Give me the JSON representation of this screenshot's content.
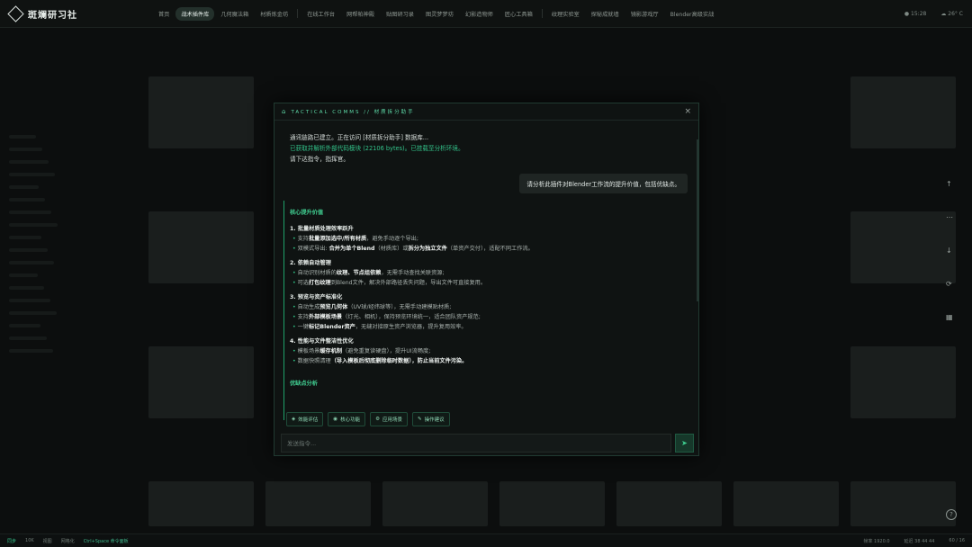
{
  "header": {
    "brand": "斑斓研习社",
    "nav": [
      "首页",
      "战术插件库",
      "几何魔法箱",
      "材质炼金坊",
      "在线工作台",
      "网帮帕神殿",
      "贴图研习录",
      "图灵梦梦坊",
      "幻影造物师",
      "匠心工具箱",
      "纹理实验室",
      "探秘成就墙",
      "镜影游戏厅",
      "Blender高级实战"
    ],
    "active_index": 1,
    "time": "15:28",
    "weather": "26° C"
  },
  "modal": {
    "title": "TACTICAL COMMS // 材质拆分助手",
    "close": "×",
    "system_lines": [
      "通讯链路已建立。正在访问 [材质拆分助手] 数据库...",
      "已获取并解析外部代码模块 (22106 bytes)。已挂载至分析环境。",
      "请下达指令，指挥官。"
    ],
    "user_message": "请分析此插件对Blender工作流的提升价值，包括优缺点。",
    "response": {
      "heading": "核心提升价值",
      "sections": [
        {
          "title": "1. 批量材质处理效率跃升",
          "items": [
            [
              "支持",
              "批量添加选中/所有材质",
              "，避免手动逐个导出;"
            ],
            [
              "双模式导出: ",
              "合并为单个Blend",
              "（材质库）或",
              "拆分为独立文件",
              "（单资产交付），适配不同工作流。"
            ]
          ]
        },
        {
          "title": "2. 依赖自动管理",
          "items": [
            [
              "自动识别材质的",
              "纹理、节点组依赖",
              "，无需手动查找关联资源;"
            ],
            [
              "可选",
              "打包纹理",
              "到Blend文件，解决外部路径丢失问题，导出文件可直接复用。"
            ]
          ]
        },
        {
          "title": "3. 预览与资产标准化",
          "items": [
            [
              "自动生成",
              "预览几何体",
              "（UV球/经纬球等），无需手动建模贴材质;"
            ],
            [
              "支持",
              "外部模板场景",
              "（灯光、相机），保持预览环境统一，适合团队资产规范;"
            ],
            [
              "一键",
              "标记Blender资产",
              "，无缝对接原生资产浏览器，提升复用效率。"
            ]
          ]
        },
        {
          "title": "4. 性能与文件整洁性优化",
          "items": [
            [
              "模板场景",
              "缓存机制",
              "（避免重复读硬盘），提升UI流畅度;"
            ],
            [
              "数据快照清理",
              "（导入模板后彻底删除临时数据），防止当前文件污染。"
            ]
          ]
        }
      ],
      "next_heading": "优缺点分析"
    },
    "chips": [
      "效能评估",
      "核心功能",
      "应用场景",
      "操作建议"
    ],
    "input_placeholder": "发送指令..."
  },
  "status": {
    "left": [
      "同步",
      "10K",
      "视图",
      "网格化",
      "Ctrl+Space 命令面板"
    ],
    "right": [
      "帧率  1920.0",
      "延迟  38 44 44",
      "60 / 16"
    ]
  }
}
